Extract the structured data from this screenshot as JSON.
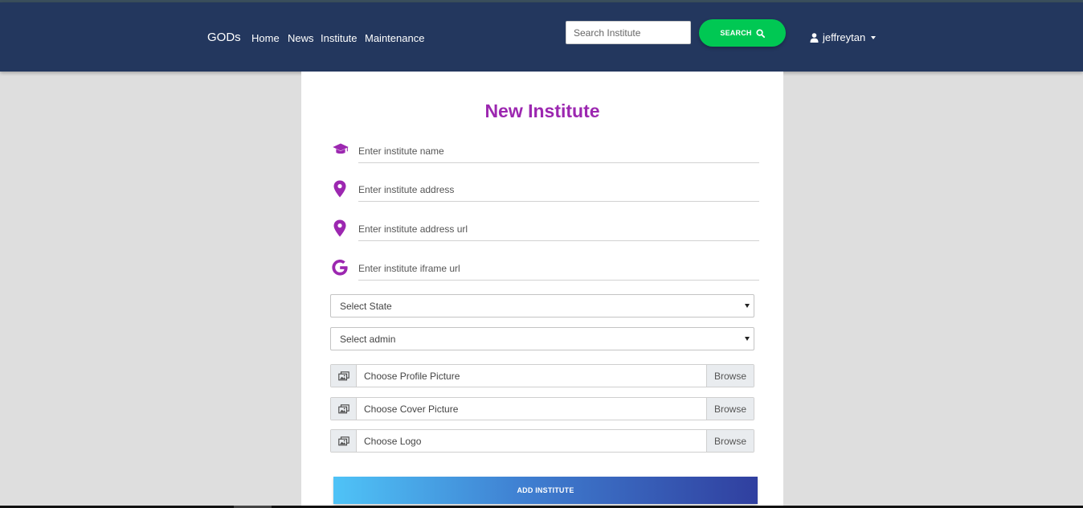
{
  "navbar": {
    "brand": "GODs",
    "links": [
      "Home",
      "News",
      "Institute",
      "Maintenance"
    ],
    "search_placeholder": "Search Institute",
    "search_button": "SEARCH",
    "user": "jeffreytan"
  },
  "form": {
    "title": "New Institute",
    "fields": [
      {
        "placeholder": "Enter institute name",
        "icon": "graduation-cap-icon"
      },
      {
        "placeholder": "Enter institute address",
        "icon": "map-marker-icon"
      },
      {
        "placeholder": "Enter institute address url",
        "icon": "map-marker-icon"
      },
      {
        "placeholder": "Enter institute iframe url",
        "icon": "google-icon"
      }
    ],
    "selects": [
      "Select State",
      "Select admin"
    ],
    "files": [
      {
        "label": "Choose Profile Picture",
        "browse": "Browse"
      },
      {
        "label": "Choose Cover Picture",
        "browse": "Browse"
      },
      {
        "label": "Choose Logo",
        "browse": "Browse"
      }
    ],
    "submit": "ADD INSTITUTE"
  },
  "colors": {
    "navbar": "#23375e",
    "accent": "#9c27b0",
    "search_button": "#00c853",
    "page_background": "#dedede"
  }
}
